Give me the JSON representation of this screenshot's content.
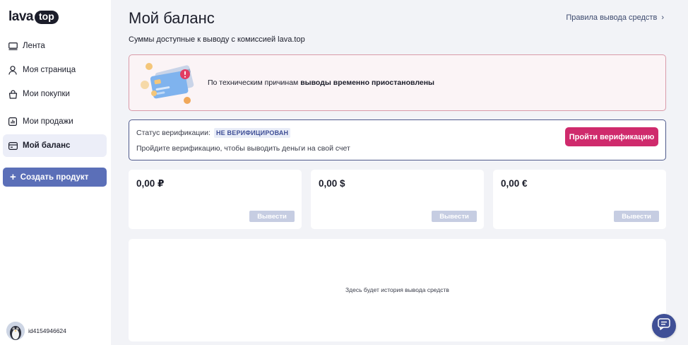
{
  "brand": {
    "logo_main": "lava",
    "logo_badge": "top"
  },
  "sidebar": {
    "items": [
      {
        "label": "Лента",
        "icon": "feed-icon",
        "active": false
      },
      {
        "label": "Моя страница",
        "icon": "user-icon",
        "active": false
      },
      {
        "label": "Мои покупки",
        "icon": "bag-icon",
        "active": false
      },
      {
        "label": "Мои продажи",
        "icon": "chart-icon",
        "active": false
      },
      {
        "label": "Мой баланс",
        "icon": "wallet-icon",
        "active": true
      }
    ],
    "create_button": {
      "plus": "+",
      "label": "Создать продукт"
    },
    "user": {
      "id": "id4154946624"
    }
  },
  "header": {
    "title": "Мой баланс",
    "rules_link": "Правила вывода средств",
    "rules_chevron": "›",
    "subtitle": "Суммы доступные к выводу с комиссией lava.top"
  },
  "alert": {
    "text_prefix": "По техническим причинам ",
    "text_bold": "выводы временно приостановлены"
  },
  "verification": {
    "status_label": "Статус верификации:",
    "status_value": "НЕ ВЕРИФИЦИРОВАН",
    "hint": "Пройдите верификацию, чтобы выводить деньги на свой счет",
    "button": "Пройти верификацию"
  },
  "balances": [
    {
      "amount": "0,00 ₽",
      "button": "Вывести"
    },
    {
      "amount": "0,00 $",
      "button": "Вывести"
    },
    {
      "amount": "0,00 €",
      "button": "Вывести"
    }
  ],
  "history": {
    "empty_text": "Здесь будет история вывода средств"
  },
  "colors": {
    "accent": "#cf2a6c",
    "primary": "#5b6fb8",
    "navy": "#3f4f96",
    "alert_border": "#d89aa9",
    "disabled_button": "#c6cde2"
  }
}
